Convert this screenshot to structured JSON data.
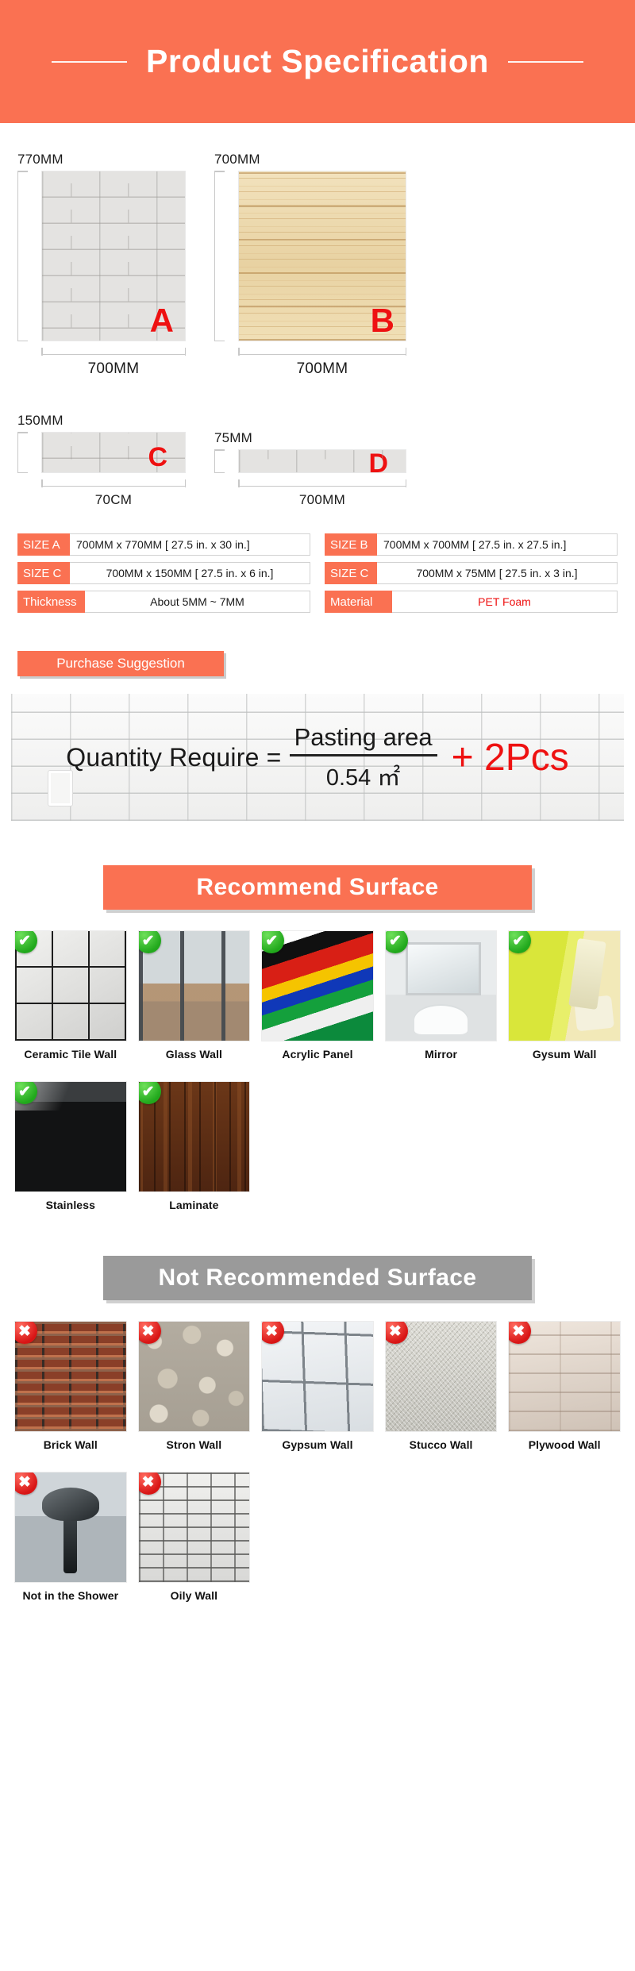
{
  "header": {
    "title": "Product Specification"
  },
  "panels": [
    {
      "letter": "A",
      "height_label": "770MM",
      "width_label": "700MM",
      "texture": "brick-white"
    },
    {
      "letter": "B",
      "height_label": "700MM",
      "width_label": "700MM",
      "texture": "wood"
    },
    {
      "letter": "C",
      "height_label": "150MM",
      "width_label": "70CM",
      "texture": "brick-white"
    },
    {
      "letter": "D",
      "height_label": "75MM",
      "width_label": "700MM",
      "texture": "brick-white"
    }
  ],
  "spec_table": {
    "left": [
      {
        "key": "SIZE A",
        "value": "700MM x 770MM [ 27.5 in. x 30 in.]"
      },
      {
        "key": "SIZE C",
        "value": "700MM x 150MM [ 27.5 in. x 6 in.]"
      },
      {
        "key": "Thickness",
        "value": "About 5MM ~ 7MM"
      }
    ],
    "right": [
      {
        "key": "SIZE B",
        "value": "700MM x 700MM [ 27.5 in. x 27.5 in.]"
      },
      {
        "key": "SIZE C",
        "value": "700MM x 75MM [ 27.5 in. x 3 in.]"
      },
      {
        "key": "Material",
        "value": "PET Foam"
      }
    ]
  },
  "purchase": {
    "tab_label": "Purchase Suggestion",
    "formula_lhs": "Quantity Require =",
    "numerator": "Pasting area",
    "denominator": "0.54 ㎡",
    "addend": "+ 2Pcs"
  },
  "recommend": {
    "heading": "Recommend Surface",
    "badge": "✔",
    "items": [
      {
        "label": "Ceramic Tile Wall",
        "texture": "ceramic"
      },
      {
        "label": "Glass Wall",
        "texture": "glass"
      },
      {
        "label": "Acrylic Panel",
        "texture": "acrylic"
      },
      {
        "label": "Mirror",
        "texture": "mirror"
      },
      {
        "label": "Gysum Wall",
        "texture": "gypsum-y"
      },
      {
        "label": "Stainless",
        "texture": "stainless"
      },
      {
        "label": "Laminate",
        "texture": "laminate"
      }
    ]
  },
  "not_recommend": {
    "heading": "Not Recommended Surface",
    "badge": "✖",
    "items": [
      {
        "label": "Brick Wall",
        "texture": "brick-red"
      },
      {
        "label": "Stron Wall",
        "texture": "stone"
      },
      {
        "label": "Gypsum Wall",
        "texture": "gypsum-g"
      },
      {
        "label": "Stucco Wall",
        "texture": "stucco"
      },
      {
        "label": "Plywood Wall",
        "texture": "plywood"
      },
      {
        "label": "Not in the Shower",
        "texture": "shower"
      },
      {
        "label": "Oily Wall",
        "texture": "oily"
      }
    ]
  },
  "colors": {
    "accent": "#fa7152",
    "gray_heading": "#9a9a9a",
    "red": "#ee1111"
  }
}
